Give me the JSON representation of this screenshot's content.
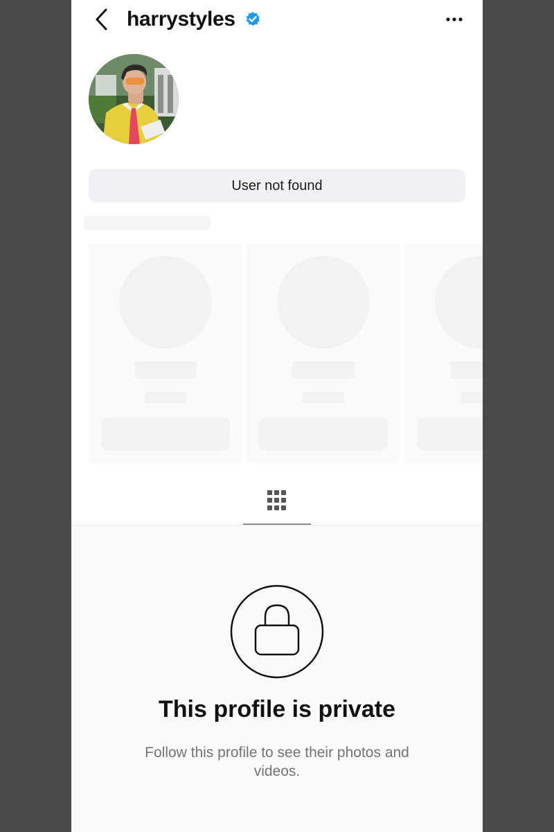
{
  "header": {
    "username": "harrystyles",
    "back_icon": "chevron-left-icon",
    "verified_icon": "verified-badge-icon",
    "more_icon": "more-horizontal-icon"
  },
  "profile": {
    "status_button": "User not found"
  },
  "tabs": {
    "grid_icon": "grid-icon"
  },
  "private": {
    "lock_icon": "lock-icon",
    "title": "This profile is private",
    "subtitle": "Follow this profile to see their photos and videos."
  },
  "colors": {
    "verified": "#1d9bf0",
    "text": "#111111",
    "muted": "#737373",
    "button_bg": "#eff1f4"
  }
}
